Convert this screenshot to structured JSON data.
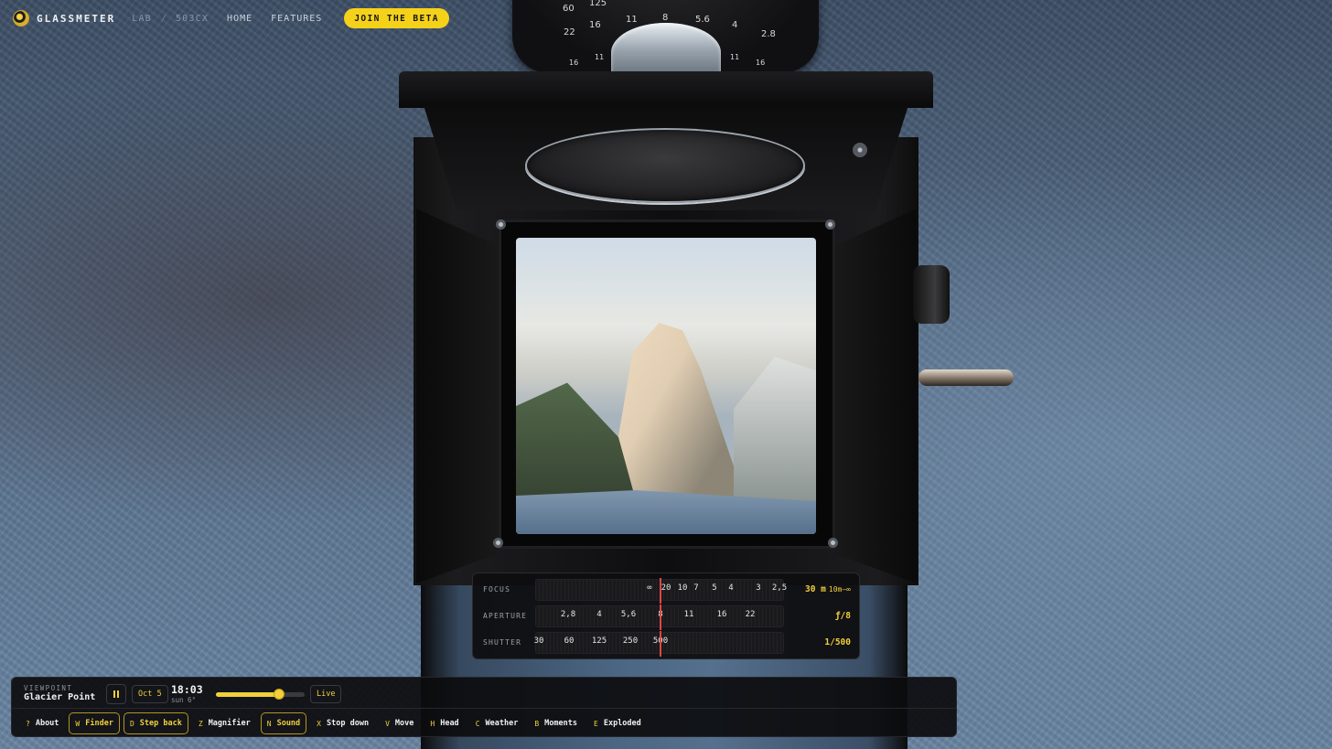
{
  "nav": {
    "brand": "GLASSMETER",
    "crumbs": [
      "LAB",
      "503CX"
    ],
    "crumb_sep": "/",
    "links": [
      "HOME",
      "FEATURES"
    ],
    "cta": "JOIN THE BETA"
  },
  "dial": {
    "numbers": [
      "60",
      "125",
      "8",
      "11",
      "16",
      "22",
      "5.6",
      "4",
      "2.8",
      "16",
      "11",
      "8",
      "11",
      "16"
    ]
  },
  "meter": {
    "focus": {
      "label": "FOCUS",
      "ticks": [
        "∞",
        "20",
        "10",
        "7",
        "5",
        "4",
        "3",
        "2,5"
      ],
      "value": "30 m",
      "range": "10m–∞"
    },
    "aperture": {
      "label": "APERTURE",
      "ticks": [
        "2,8",
        "4",
        "5,6",
        "8",
        "11",
        "16",
        "22"
      ],
      "value": "ƒ/8"
    },
    "shutter": {
      "label": "SHUTTER",
      "ticks": [
        "30",
        "60",
        "125",
        "250",
        "500"
      ],
      "value": "1/500"
    }
  },
  "controls": {
    "viewpoint_label": "VIEWPOINT",
    "viewpoint": "Glacier Point",
    "date": "Oct 5",
    "time": "18:03",
    "sun": "sun 6°",
    "time_slider_fraction": 0.71,
    "live": "Live",
    "keys": [
      {
        "key": "?",
        "label": "About",
        "active": false
      },
      {
        "key": "W",
        "label": "Finder",
        "active": true
      },
      {
        "key": "D",
        "label": "Step back",
        "active": true
      },
      {
        "key": "Z",
        "label": "Magnifier",
        "active": false
      },
      {
        "key": "N",
        "label": "Sound",
        "active": true
      },
      {
        "key": "X",
        "label": "Stop down",
        "active": false
      },
      {
        "key": "V",
        "label": "Move",
        "active": false
      },
      {
        "key": "H",
        "label": "Head",
        "active": false
      },
      {
        "key": "C",
        "label": "Weather",
        "active": false
      },
      {
        "key": "B",
        "label": "Moments",
        "active": false
      },
      {
        "key": "E",
        "label": "Exploded",
        "active": false
      }
    ]
  },
  "colors": {
    "accent": "#f3cf3a",
    "needle": "#e04646"
  }
}
